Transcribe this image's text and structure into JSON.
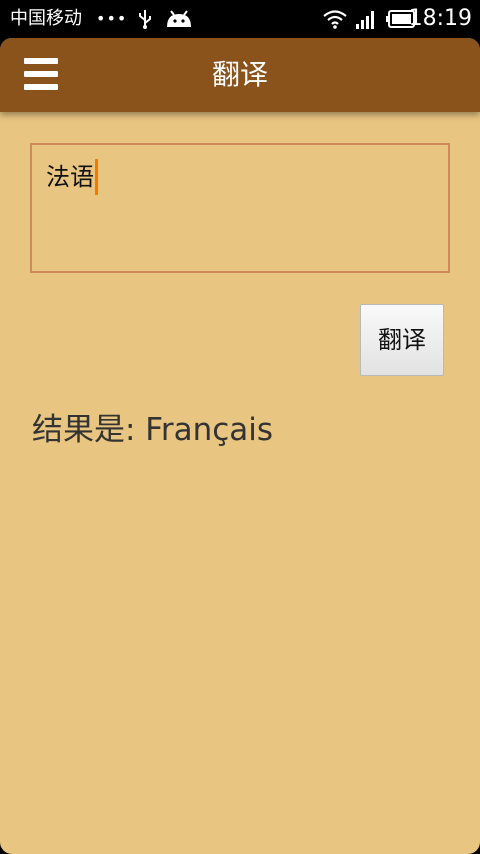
{
  "status_bar": {
    "carrier": "中国移动",
    "dots": "•••",
    "time": "18:19",
    "icons": [
      "usb-icon",
      "android-icon",
      "wifi-icon",
      "signal-icon",
      "battery-icon"
    ]
  },
  "action_bar": {
    "menu_icon": "hamburger-menu-icon",
    "title": "翻译"
  },
  "input": {
    "value": "法语"
  },
  "translate_button": {
    "label": "翻译"
  },
  "result": {
    "text": "结果是:  Français"
  },
  "colors": {
    "background": "#e8c580",
    "action_bar": "#8a531c",
    "input_border": "#d08a5a",
    "cursor": "#f07b00"
  }
}
